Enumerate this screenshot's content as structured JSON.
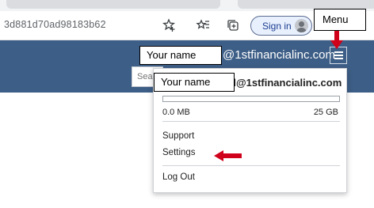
{
  "browser": {
    "url_fragment": "3d881d70ad98183b62",
    "sign_in_label": "Sign in"
  },
  "header": {
    "account_suffix": "@1stfinancialinc.com",
    "search_placeholder": "Sea"
  },
  "dropdown": {
    "email_suffix": "d@1stfinancialinc.com",
    "storage_used": "0.0 MB",
    "storage_total": "25 GB",
    "storage_fraction": 0.0,
    "items": [
      {
        "label": "Support"
      },
      {
        "label": "Settings"
      },
      {
        "label": "Log Out"
      }
    ]
  },
  "annotations": {
    "menu_callout": "Menu",
    "name_callout_header": "Your name",
    "name_callout_dropdown": "Your name",
    "arrow_color": "#d0021b"
  },
  "colors": {
    "header_bg": "#3d5e86"
  }
}
